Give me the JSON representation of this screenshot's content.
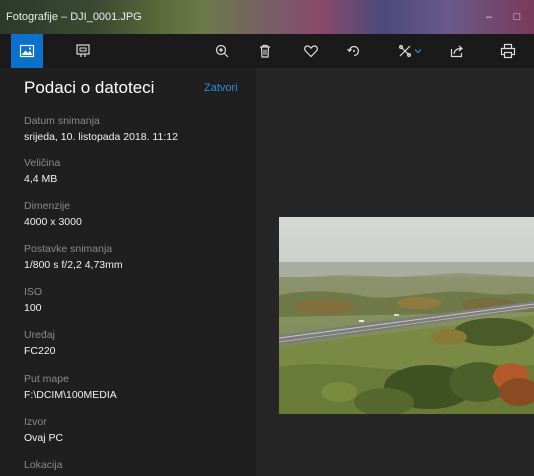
{
  "window": {
    "title": "Fotografije – DJI_0001.JPG",
    "minimize_glyph": "–",
    "maximize_glyph": "□"
  },
  "toolbar": {
    "items": [
      {
        "name": "view-image",
        "icon": "image-icon",
        "active": true
      },
      {
        "name": "slideshow",
        "icon": "slideshow-icon"
      },
      {
        "name": "zoom",
        "icon": "zoom-in-icon"
      },
      {
        "name": "delete",
        "icon": "trash-icon"
      },
      {
        "name": "favorite",
        "icon": "heart-icon"
      },
      {
        "name": "rotate",
        "icon": "rotate-icon"
      },
      {
        "name": "edit",
        "icon": "edit-tools-icon"
      },
      {
        "name": "share",
        "icon": "share-icon"
      },
      {
        "name": "print",
        "icon": "print-icon"
      }
    ],
    "accent": "#0a72cc"
  },
  "info_panel": {
    "header": "Podaci o datoteci",
    "close_label": "Zatvori",
    "fields": [
      {
        "label": "Datum snimanja",
        "value": "srijeda, 10. listopada 2018. 11:12"
      },
      {
        "label": "Veličina",
        "value": "4,4 MB"
      },
      {
        "label": "Dimenzije",
        "value": "4000 x 3000"
      },
      {
        "label": "Postavke snimanja",
        "value": "1/800 s f/2,2 4,73mm"
      },
      {
        "label": "ISO",
        "value": "100"
      },
      {
        "label": "Uređaj",
        "value": "FC220"
      },
      {
        "label": "Put mape",
        "value": "F:\\DCIM\\100MEDIA"
      },
      {
        "label": "Izvor",
        "value": "Ovaj PC"
      },
      {
        "label": "Lokacija",
        "value": ""
      }
    ]
  }
}
